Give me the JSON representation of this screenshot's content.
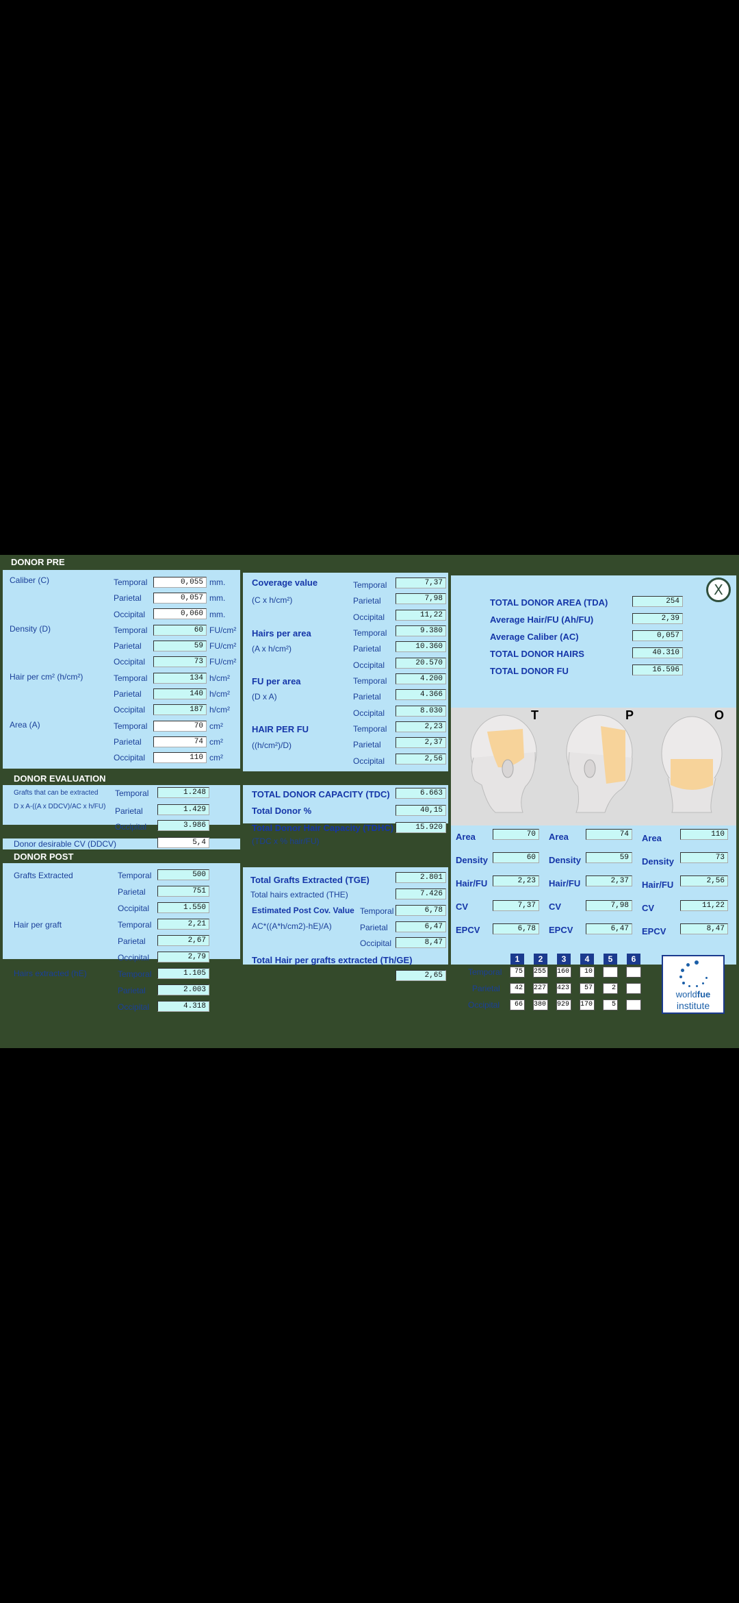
{
  "colors": {
    "panel": "#b9e3f7",
    "header": "#344a2b",
    "field": "#c8f8f6",
    "label": "#1a3f99",
    "table_header": "#1b3a8e"
  },
  "donor_pre": {
    "title": "DONOR PRE",
    "caliber_label": "Caliber (C)",
    "density_label": "Density (D)",
    "hair_per_cm2_label": "Hair per cm² (h/cm²)",
    "area_label": "Area (A)",
    "zones": [
      "Temporal",
      "Parietal",
      "Occipital"
    ],
    "caliber": [
      "0,055",
      "0,057",
      "0,060"
    ],
    "caliber_unit": "mm.",
    "density": [
      "60",
      "59",
      "73"
    ],
    "density_unit": "FU/cm²",
    "hair_per_cm2": [
      "134",
      "140",
      "187"
    ],
    "hair_unit": "h/cm²",
    "area": [
      "70",
      "74",
      "110"
    ],
    "area_unit": "cm²"
  },
  "coverage": {
    "cv_label": "Coverage value",
    "cv_formula": "(C x h/cm²)",
    "hpa_label": "Hairs per area",
    "hpa_formula": "(A x h/cm²)",
    "fupa_label": "FU per area",
    "fupa_formula": "(D x A)",
    "hpfu_label": "HAIR PER FU",
    "hpfu_formula": "((h/cm²)/D)",
    "zones": [
      "Temporal",
      "Parietal",
      "Occipital"
    ],
    "cv": [
      "7,37",
      "7,98",
      "11,22"
    ],
    "hpa": [
      "9.380",
      "10.360",
      "20.570"
    ],
    "fupa": [
      "4.200",
      "4.366",
      "8.030"
    ],
    "hpfu": [
      "2,23",
      "2,37",
      "2,56"
    ]
  },
  "totals": {
    "tda_label": "TOTAL DONOR AREA (TDA)",
    "tda": "254",
    "ahfu_label": "Average Hair/FU (Ah/FU)",
    "ahfu": "2,39",
    "ac_label": "Average Caliber (AC)",
    "ac": "0,057",
    "tdh_label": "TOTAL DONOR HAIRS",
    "tdh": "40.310",
    "tdfu_label": "TOTAL DONOR FU",
    "tdfu": "16.596",
    "close_label": "X"
  },
  "heads": {
    "letters": [
      "T",
      "P",
      "O"
    ]
  },
  "zone_stats": {
    "labels": {
      "area": "Area",
      "density": "Density",
      "hair_fu": "Hair/FU",
      "cv": "CV",
      "epcv": "EPCV"
    },
    "temporal": {
      "area": "70",
      "density": "60",
      "hair_fu": "2,23",
      "cv": "7,37",
      "epcv": "6,78"
    },
    "parietal": {
      "area": "74",
      "density": "59",
      "hair_fu": "2,37",
      "cv": "7,98",
      "epcv": "6,47"
    },
    "occipital": {
      "area": "110",
      "density": "73",
      "hair_fu": "2,56",
      "cv": "11,22",
      "epcv": "8,47"
    }
  },
  "fu_table": {
    "headers": [
      "1",
      "2",
      "3",
      "4",
      "5",
      "6"
    ],
    "rows": [
      {
        "label": "Temporal",
        "cells": [
          "75",
          "255",
          "160",
          "10",
          "",
          ""
        ]
      },
      {
        "label": "Parietal",
        "cells": [
          "42",
          "227",
          "423",
          "57",
          "2",
          ""
        ]
      },
      {
        "label": "Occipital",
        "cells": [
          "66",
          "380",
          "929",
          "170",
          "5",
          ""
        ]
      }
    ]
  },
  "logo": {
    "line1_a": "world",
    "line1_b": "fue",
    "line2": "institute"
  },
  "donor_eval": {
    "title": "DONOR EVALUATION",
    "grafts_label": "Grafts that can be extracted",
    "formula": "D x A-((A x DDCV)/AC x h/FU)",
    "zones": [
      "Temporal",
      "Parietal",
      "Occipital"
    ],
    "values": [
      "1.248",
      "1.429",
      "3.986"
    ],
    "ddcv_label": "Donor desirable CV (DDCV)",
    "ddcv": "5,4"
  },
  "capacity": {
    "tdc_label": "TOTAL DONOR CAPACITY (TDC)",
    "tdc": "6.663",
    "tdp_label": "Total Donor %",
    "tdp": "40,15",
    "tdhc_label": "Total Donor Hair Capacity (TDHC)",
    "tdhc_formula": "(TDC x % hair/FU)",
    "tdhc": "15.920"
  },
  "donor_post": {
    "title": "DONOR POST",
    "grafts_label": "Grafts Extracted",
    "hpg_label": "Hair per graft",
    "he_label": "Hairs extracted (hE)",
    "zones": [
      "Temporal",
      "Parietal",
      "Occipital"
    ],
    "grafts": [
      "500",
      "751",
      "1.550"
    ],
    "hpg": [
      "2,21",
      "2,67",
      "2,79"
    ],
    "he": [
      "1.105",
      "2.003",
      "4.318"
    ]
  },
  "post_totals": {
    "tge_label": "Total Grafts Extracted (TGE)",
    "tge": "2.801",
    "the_label": "Total hairs extracted (THE)",
    "the": "7.426",
    "epcv_label": "Estimated Post Cov. Value",
    "epcv_formula": "AC*((A*h/cm2)-hE)/A)",
    "zones": [
      "Temporal",
      "Parietal",
      "Occipital"
    ],
    "epcv": [
      "6,78",
      "6,47",
      "8,47"
    ],
    "thge_label": "Total Hair per grafts extracted (Th/GE)",
    "thge": "2,65"
  }
}
